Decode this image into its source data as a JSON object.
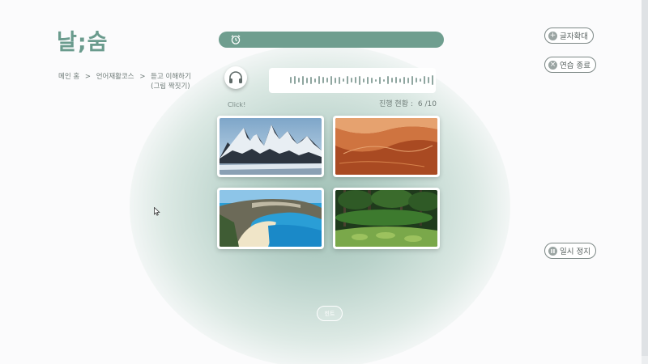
{
  "app": {
    "logo": "날;숨"
  },
  "breadcrumb": {
    "items": [
      "메인 홈",
      ">",
      "언어재활코스",
      ">"
    ],
    "last_line1": "듣고 이해하기",
    "last_line2": "(그림 짝짓기)"
  },
  "audio": {
    "click_label": "Click!"
  },
  "progress": {
    "label": "진행 현황 :",
    "value": "6 /10"
  },
  "choices": [
    {
      "icon": "snowy-mountain-image"
    },
    {
      "icon": "desert-dunes-image"
    },
    {
      "icon": "beach-cove-image"
    },
    {
      "icon": "rainforest-image"
    }
  ],
  "controls": {
    "zoom_label": "글자확대",
    "end_label": "연습 종료",
    "pause_label": "일시 정지",
    "hint_label": "힌트"
  },
  "colors": {
    "accent": "#6f9e8f",
    "logo": "#6a9b8d"
  }
}
